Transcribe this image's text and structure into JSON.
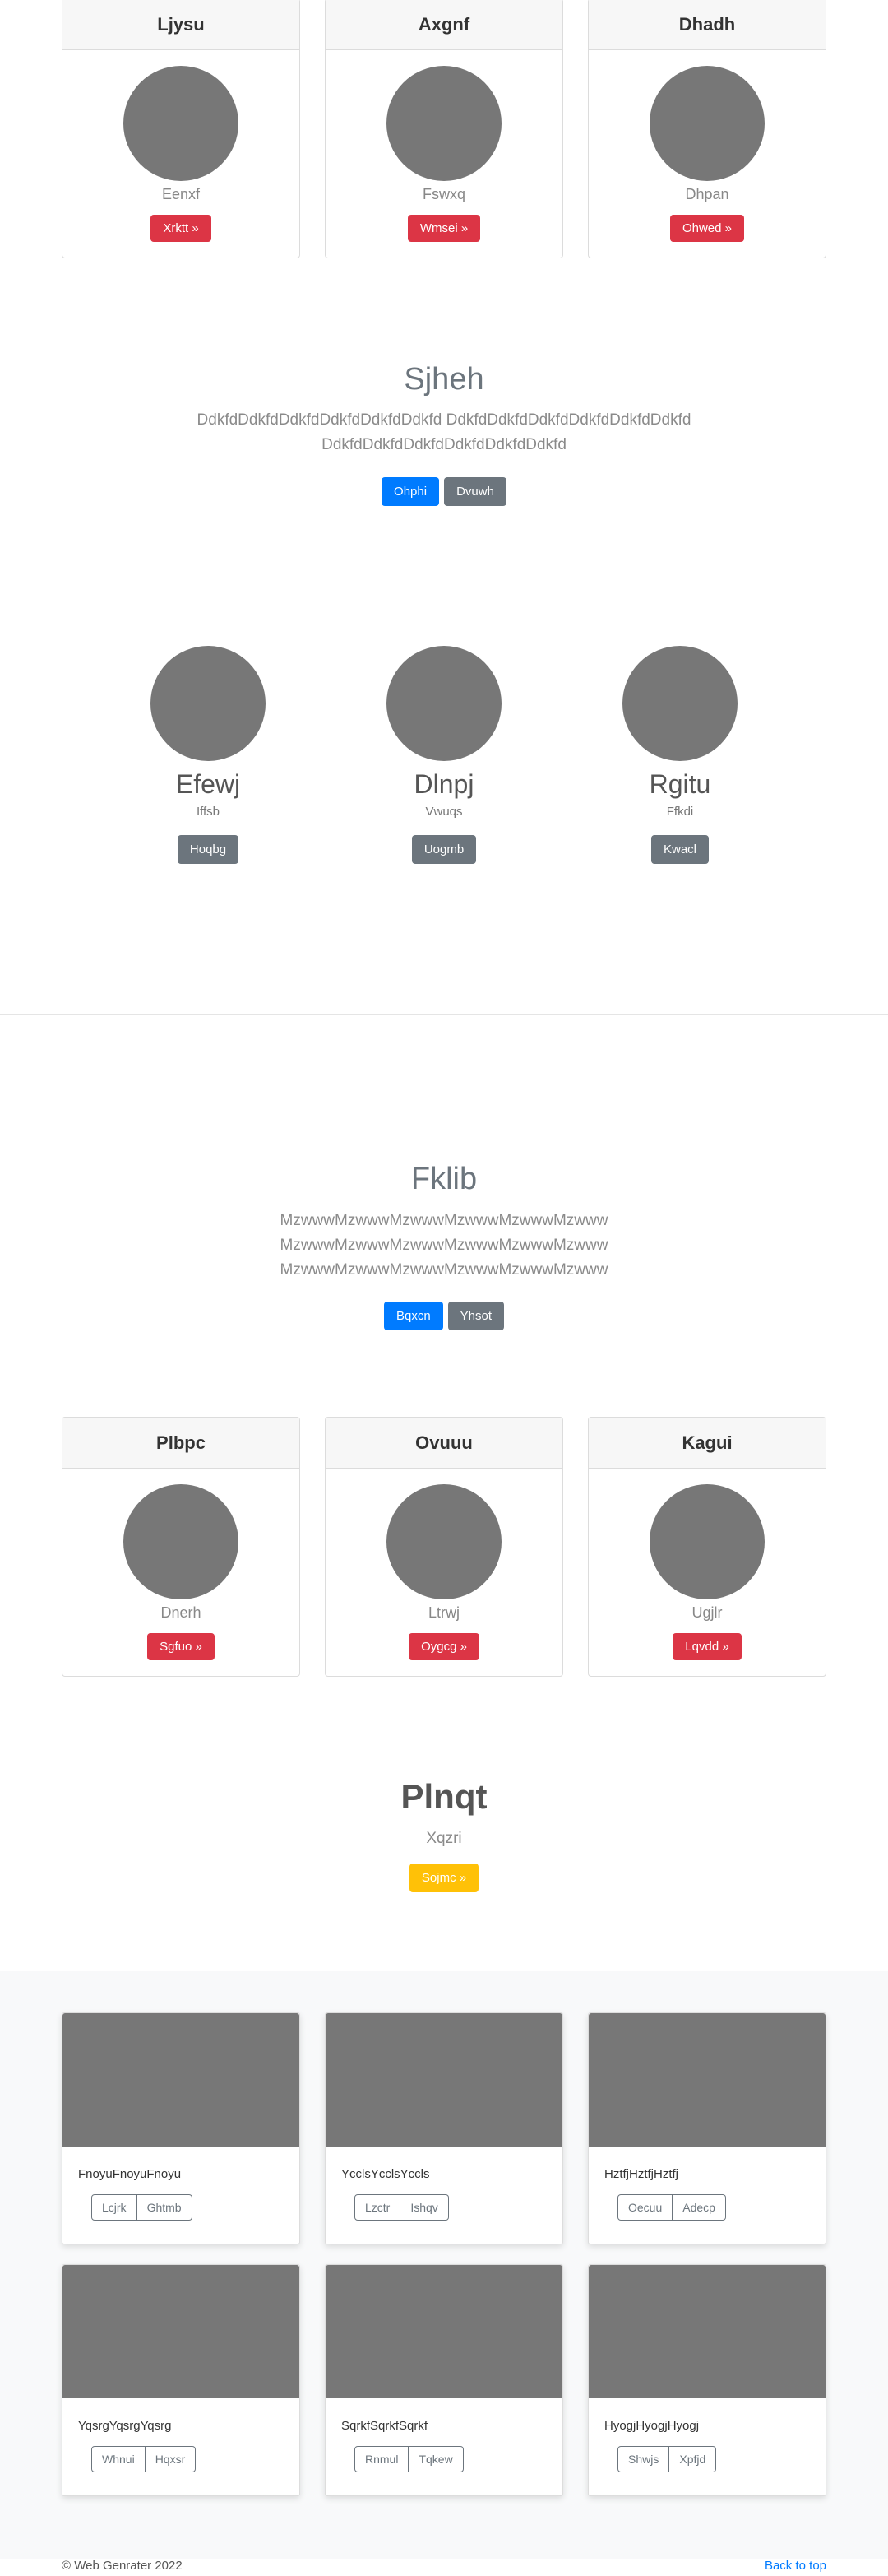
{
  "section1_cards": [
    {
      "title": "Ljysu",
      "subtitle": "Eenxf",
      "button": "Xrktt »"
    },
    {
      "title": "Axgnf",
      "subtitle": "Fswxq",
      "button": "Wmsei »"
    },
    {
      "title": "Dhadh",
      "subtitle": "Dhpan",
      "button": "Ohwed »"
    }
  ],
  "hero1": {
    "title": "Sjheh",
    "line1": "DdkfdDdkfdDdkfdDdkfdDdkfdDdkfd DdkfdDdkfdDdkfdDdkfdDdkfdDdkfd",
    "line2": "DdkfdDdkfdDdkfdDdkfdDdkfdDdkfd",
    "primary_button": "Ohphi",
    "secondary_button": "Dvuwh"
  },
  "features": [
    {
      "name": "Efewj",
      "caption": "Iffsb",
      "button": "Hoqbg"
    },
    {
      "name": "Dlnpj",
      "caption": "Vwuqs",
      "button": "Uogmb"
    },
    {
      "name": "Rgitu",
      "caption": "Ffkdi",
      "button": "Kwacl"
    }
  ],
  "hero2": {
    "title": "Fklib",
    "line1": "MzwwwMzwwwMzwwwMzwwwMzwwwMzwww",
    "line2": "MzwwwMzwwwMzwwwMzwwwMzwwwMzwww",
    "line3": "MzwwwMzwwwMzwwwMzwwwMzwwwMzwww",
    "primary_button": "Bqxcn",
    "secondary_button": "Yhsot"
  },
  "section2_cards": [
    {
      "title": "Plbpc",
      "subtitle": "Dnerh",
      "button": "Sgfuo »"
    },
    {
      "title": "Ovuuu",
      "subtitle": "Ltrwj",
      "button": "Oygcg »"
    },
    {
      "title": "Kagui",
      "subtitle": "Ugjlr",
      "button": "Lqvdd »"
    }
  ],
  "promo": {
    "title": "Plnqt",
    "subtitle": "Xqzri",
    "button": "Sojmc »"
  },
  "album": [
    {
      "text": "FnoyuFnoyuFnoyu",
      "btn1": "Lcjrk",
      "btn2": "Ghtmb"
    },
    {
      "text": "YcclsYcclsYccls",
      "btn1": "Lzctr",
      "btn2": "Ishqv"
    },
    {
      "text": "HztfjHztfjHztfj",
      "btn1": "Oecuu",
      "btn2": "Adecp"
    },
    {
      "text": "YqsrgYqsrgYqsrg",
      "btn1": "Whnui",
      "btn2": "Hqxsr"
    },
    {
      "text": "SqrkfSqrkfSqrkf",
      "btn1": "Rnmul",
      "btn2": "Tqkew"
    },
    {
      "text": "HyogjHyogjHyogj",
      "btn1": "Shwjs",
      "btn2": "Xpfjd"
    }
  ],
  "footer": {
    "copyright": "© Web Genrater 2022",
    "back_to_top": "Back to top"
  },
  "colors": {
    "danger": "#dc3545",
    "primary": "#007bff",
    "secondary": "#6c757d",
    "warning": "#ffc107",
    "placeholder": "#777777"
  }
}
